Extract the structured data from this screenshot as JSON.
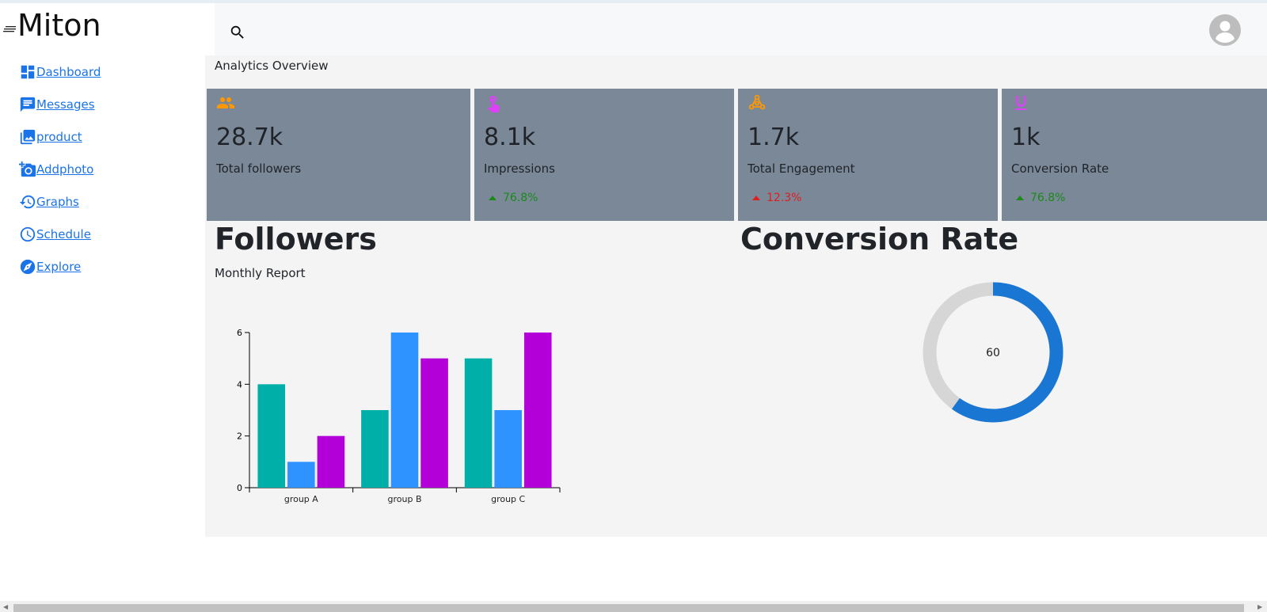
{
  "app": {
    "brand": "Miton"
  },
  "sidebar": {
    "items": [
      {
        "label": "Dashboard",
        "icon": "dashboard-icon"
      },
      {
        "label": " Messages",
        "icon": "message-icon"
      },
      {
        "label": "product",
        "icon": "image-icon"
      },
      {
        "label": " Addphoto",
        "icon": "add-photo-icon"
      },
      {
        "label": "Graphs",
        "icon": "history-icon"
      },
      {
        "label": " Schedule",
        "icon": "clock-icon"
      },
      {
        "label": " Explore",
        "icon": "compass-icon"
      }
    ]
  },
  "header": {
    "search_icon": "search-icon",
    "avatar_icon": "account-icon"
  },
  "main": {
    "section_label": "Analytics Overview",
    "cards": [
      {
        "value": "28.7k",
        "label": "Total followers",
        "change": "",
        "icon": "group-icon",
        "icon_color": "#ff9800"
      },
      {
        "value": "8.1k",
        "label": "Impressions",
        "change": "76.8%",
        "change_color": "#1a8a1a",
        "icon": "touch-icon",
        "icon_color": "#e040fb"
      },
      {
        "value": "1.7k",
        "label": "Total Engagement",
        "change": "12.3%",
        "change_color": "#e01e1e",
        "icon": "hub-icon",
        "icon_color": "#ff9800"
      },
      {
        "value": "1k",
        "label": "Conversion Rate",
        "change": "76.8%",
        "change_color": "#1a8a1a",
        "icon": "underline-icon",
        "icon_color": "#e040fb"
      }
    ],
    "followers": {
      "title": "Followers",
      "subtitle": "Monthly Report"
    },
    "conversion": {
      "title": "Conversion Rate"
    }
  },
  "colors": {
    "card_bg": "#7a8898",
    "link": "#1a73e8",
    "series": [
      "#00b0a8",
      "#2e93ff",
      "#b300d9"
    ],
    "donut_fill": "#1976d2",
    "donut_track": "#d6d6d6"
  },
  "chart_data": [
    {
      "type": "bar",
      "categories": [
        "group A",
        "group B",
        "group C"
      ],
      "series": [
        {
          "values": [
            4,
            3,
            5
          ]
        },
        {
          "values": [
            1,
            6,
            3
          ]
        },
        {
          "values": [
            2,
            5,
            6
          ]
        }
      ],
      "ylim": [
        0,
        6
      ],
      "yticks": [
        0,
        2,
        4,
        6
      ]
    },
    {
      "type": "pie",
      "value": 60,
      "max": 100,
      "center_label": "60"
    }
  ]
}
